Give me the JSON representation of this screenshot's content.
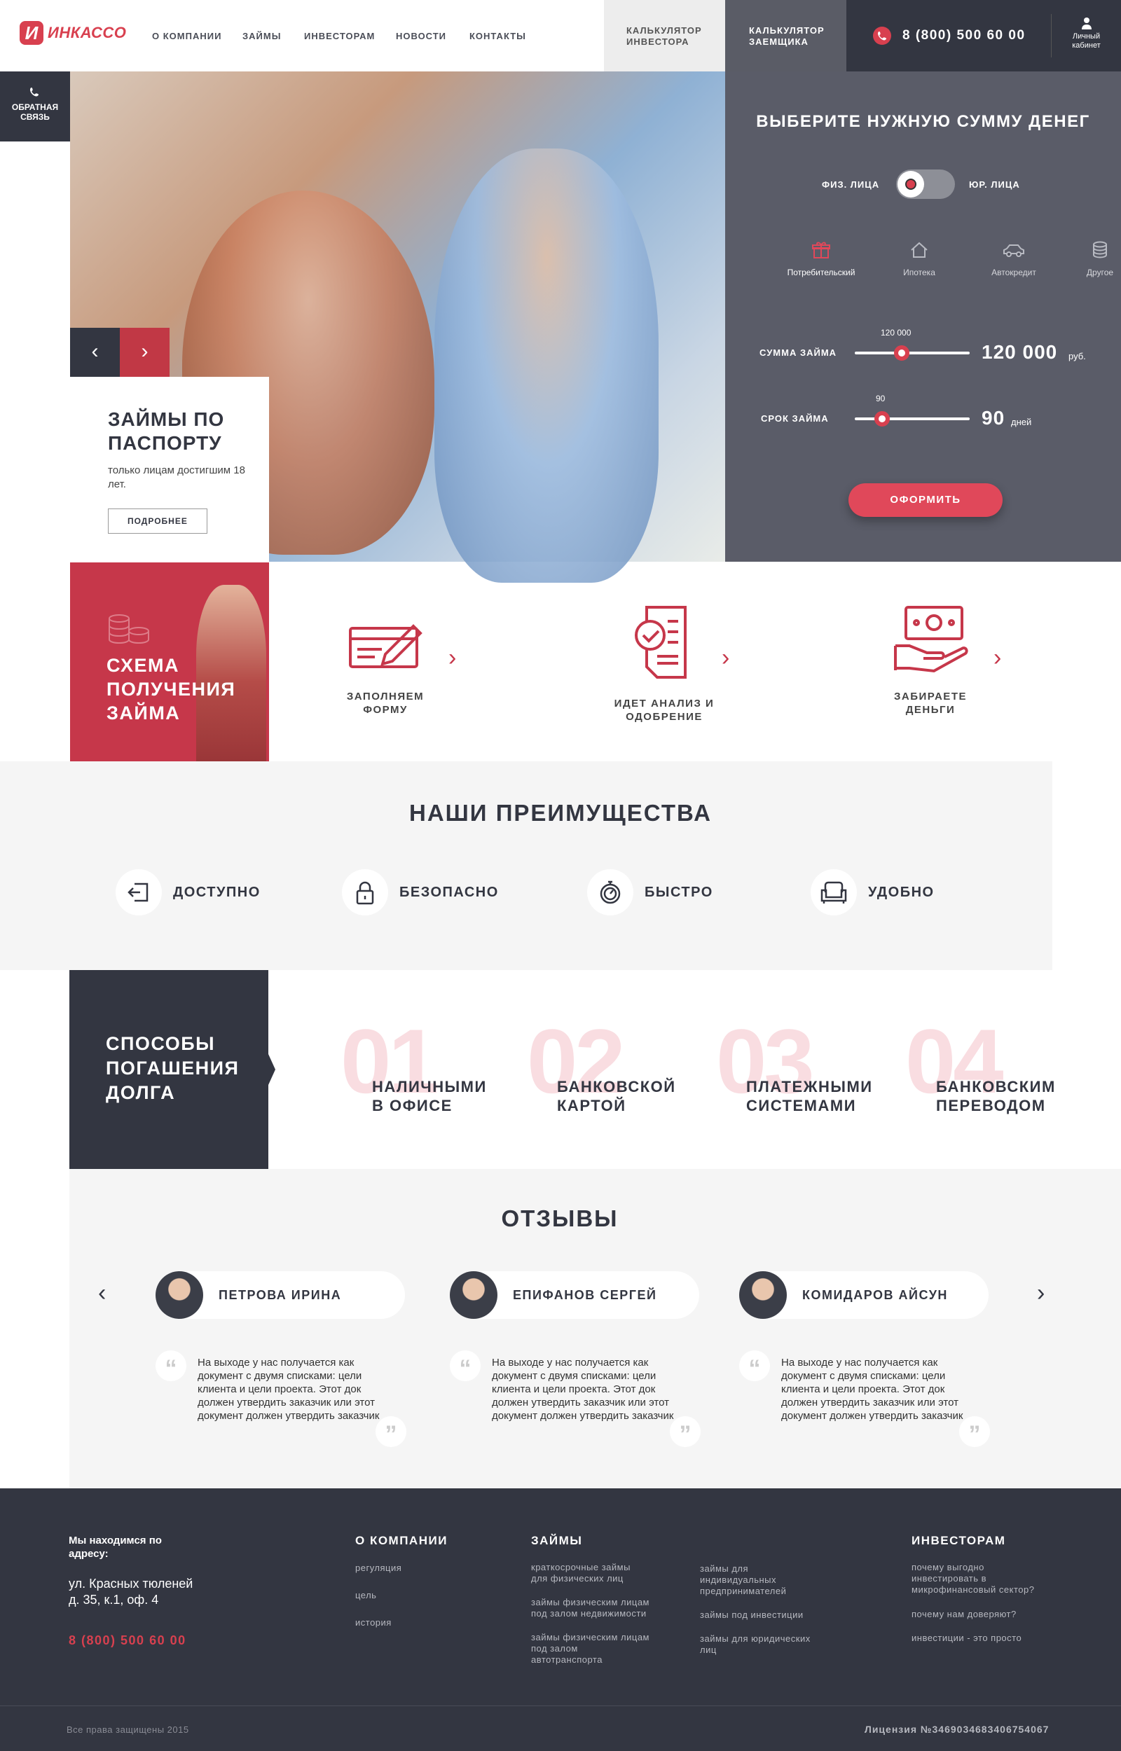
{
  "header": {
    "logo_mark": "И",
    "logo_text": "ИНКАССО",
    "nav": [
      "О КОМПАНИИ",
      "ЗАЙМЫ",
      "ИНВЕСТОРАМ",
      "НОВОСТИ",
      "КОНТАКТЫ"
    ],
    "calc_investor": [
      "КАЛЬКУЛЯТОР",
      "ИНВЕСТОРА"
    ],
    "calc_borrower": [
      "КАЛЬКУЛЯТОР",
      "ЗАЕМЩИКА"
    ],
    "phone": "8 (800) 500 60 00",
    "cabinet": [
      "Личный",
      "кабинет"
    ]
  },
  "feedback": [
    "ОБРАТНАЯ",
    "СВЯЗЬ"
  ],
  "hero": {
    "title": "ЗАЙМЫ ПО ПАСПОРТУ",
    "subtitle": "только лицам достигшим 18 лет.",
    "button": "ПОДРОБНЕЕ",
    "prev": "‹",
    "next": "›"
  },
  "calculator": {
    "title": "ВЫБЕРИТЕ НУЖНУЮ СУММУ ДЕНЕГ",
    "toggle_left": "ФИЗ. ЛИЦА",
    "toggle_right": "ЮР. ЛИЦА",
    "types": [
      "Потребительский",
      "Ипотека",
      "Автокредит",
      "Другое"
    ],
    "amount": {
      "label": "СУММА ЗАЙМА",
      "tick": "120 000",
      "value": "120 000",
      "unit": "руб.",
      "fraction": 0.41
    },
    "term": {
      "label": "СРОК ЗАЙМА",
      "tick": "90",
      "value": "90",
      "unit": "дней",
      "fraction": 0.24
    },
    "apply": "ОФОРМИТЬ"
  },
  "scheme": {
    "title": [
      "СХЕМА",
      "ПОЛУЧЕНИЯ",
      "ЗАЙМА"
    ],
    "steps": [
      {
        "label": [
          "ЗАПОЛНЯЕМ",
          "ФОРМУ"
        ]
      },
      {
        "label": [
          "ИДЕТ АНАЛИЗ И",
          "ОДОБРЕНИЕ"
        ]
      },
      {
        "label": [
          "ЗАБИРАЕТЕ",
          "ДЕНЬГИ"
        ]
      }
    ]
  },
  "advantages": {
    "title": "НАШИ ПРЕИМУЩЕСТВА",
    "items": [
      "ДОСТУПНО",
      "БЕЗОПАСНО",
      "БЫСТРО",
      "УДОБНО"
    ]
  },
  "repay": {
    "title": [
      "СПОСОБЫ",
      "ПОГАШЕНИЯ",
      "ДОЛГА"
    ],
    "items": [
      {
        "num": "01",
        "label": [
          "НАЛИЧНЫМИ",
          "В ОФИСЕ"
        ]
      },
      {
        "num": "02",
        "label": [
          "БАНКОВСКОЙ",
          "КАРТОЙ"
        ]
      },
      {
        "num": "03",
        "label": [
          "ПЛАТЕЖНЫМИ",
          "СИСТЕМАМИ"
        ]
      },
      {
        "num": "04",
        "label": [
          "БАНКОВСКИМ",
          "ПЕРЕВОДОМ"
        ]
      }
    ]
  },
  "reviews": {
    "title": "ОТЗЫВЫ",
    "items": [
      {
        "name": "ПЕТРОВА ИРИНА",
        "text": "На выходе у нас получается как документ с двумя списками: цели клиента и цели проекта. Этот док должен утвердить заказчик или этот документ должен утвердить заказчик"
      },
      {
        "name": "ЕПИФАНОВ СЕРГЕЙ",
        "text": "На выходе у нас получается как документ с двумя списками: цели клиента и цели проекта. Этот док должен утвердить заказчик или этот документ должен утвердить заказчик"
      },
      {
        "name": "КОМИДАРОВ АЙСУН",
        "text": "На выходе у нас получается как документ с двумя списками: цели клиента и цели проекта. Этот док должен утвердить заказчик или этот документ должен утвердить заказчик"
      }
    ],
    "quote_open": "“",
    "quote_close": "”"
  },
  "footer": {
    "address_title": [
      "Мы находимся по",
      "адресу:"
    ],
    "address": [
      "ул. Красных тюленей",
      "д. 35, к.1, оф. 4"
    ],
    "phone": "8 (800) 500 60 00",
    "company": {
      "title": "О КОМПАНИИ",
      "links": [
        "регуляция",
        "цель",
        "история"
      ]
    },
    "loans": {
      "title": "ЗАЙМЫ",
      "col1": [
        [
          "краткосрочные займы",
          "для физических лиц"
        ],
        [
          "займы физическим лицам",
          "под залом недвижимости"
        ],
        [
          "займы физическим лицам",
          "под залом",
          "автотранспорта"
        ]
      ],
      "col2": [
        [
          "займы для",
          "индивидуальных",
          "предпринимателей"
        ],
        [
          "займы под инвестиции"
        ],
        [
          "займы для юридических",
          "лиц"
        ]
      ]
    },
    "investors": {
      "title": "ИНВЕСТОРАМ",
      "links": [
        [
          "почему выгодно",
          "инвестировать в",
          "микрофинансовый сектор?"
        ],
        [
          "почему нам доверяют?"
        ],
        [
          "инвестиции - это просто"
        ]
      ]
    },
    "copyright": "Все права защищены 2015",
    "license": "Лицензия №3469034683406754067"
  },
  "colors": {
    "accent": "#d8404f",
    "dark": "#333641",
    "light": "#f5f5f5"
  }
}
